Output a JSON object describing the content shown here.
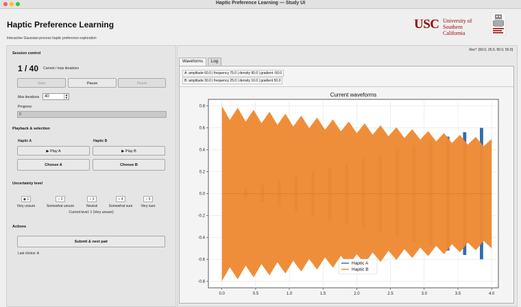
{
  "window": {
    "title": "Haptic Preference Learning — Study UI"
  },
  "header": {
    "title": "Haptic Preference Learning",
    "subtitle": "Interactive Gaussian-process haptic preference exploration",
    "logo_text": "USC",
    "logo_university": "University of Southern California"
  },
  "session": {
    "heading": "Session control",
    "iteration_display": "1 / 40",
    "iteration_caption": "Current / max iterations",
    "start_label": "Start",
    "pause_label": "Pause",
    "reset_label": "Reset",
    "max_iter_label": "Max iterations",
    "max_iter_value": "40",
    "progress_label": "Progress",
    "progress_text": "0",
    "progress_value": 0
  },
  "playback": {
    "heading": "Playback & selection",
    "a_label": "Haptic A",
    "b_label": "Haptic B",
    "play_a": "▶ Play A",
    "play_b": "▶ Play B",
    "choose_a": "Choose A",
    "choose_b": "Choose B"
  },
  "uncertainty": {
    "heading": "Uncertainty level",
    "options": [
      {
        "value": "1",
        "label": "Very unsure"
      },
      {
        "value": "2",
        "label": "Somewhat unsure"
      },
      {
        "value": "3",
        "label": "Neutral"
      },
      {
        "value": "4",
        "label": "Somewhat sure"
      },
      {
        "value": "5",
        "label": "Very sure"
      }
    ],
    "selected": "1",
    "current_text": "Current level: 1 (Very unsure)"
  },
  "actions": {
    "heading": "Actions",
    "submit_label": "Submit & next pair",
    "last_choice": "Last choice: A"
  },
  "recommendation": "Rec*: [60.0, 25.0, 90.0, 50.0]",
  "tabs": [
    {
      "label": "Waveforms",
      "active": true
    },
    {
      "label": "Log",
      "active": false
    }
  ],
  "params": {
    "a": "A: amplitude 60.0 | frequency 75.0 | density 90.0 | gradient -50.0",
    "b": "B: amplitude 30.0 | frequency 25.0 | density 10.0 | gradient 50.0"
  },
  "colors": {
    "series_a": "#2f6db0",
    "series_b": "#ee8a34",
    "brand": "#990000"
  },
  "chart_data": {
    "type": "line",
    "title": "Current waveforms",
    "xlim": [
      -0.2,
      4.1
    ],
    "ylim": [
      -0.86,
      0.86
    ],
    "xticks": [
      0.0,
      0.5,
      1.0,
      1.5,
      2.0,
      2.5,
      3.0,
      3.5,
      4.0
    ],
    "yticks": [
      -0.8,
      -0.6,
      -0.4,
      -0.2,
      0.0,
      0.2,
      0.4,
      0.6,
      0.8
    ],
    "grid": true,
    "legend_position": "bottom-center",
    "series": [
      {
        "name": "Haptic A",
        "x_range": [
          0.0,
          4.0
        ],
        "amplitude_start": 0.0,
        "amplitude_end": 0.6
      },
      {
        "name": "Haptic B",
        "x_range": [
          0.0,
          4.0
        ],
        "amplitude_start": 0.8,
        "amplitude_end": 0.5
      }
    ]
  }
}
